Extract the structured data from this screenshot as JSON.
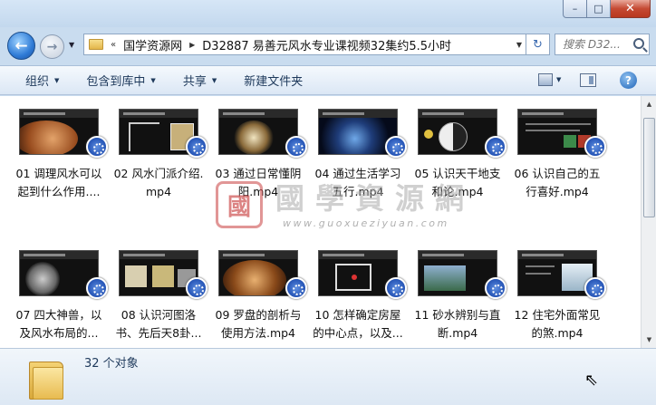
{
  "window": {
    "min_label": "–",
    "max_label": "□",
    "close_label": "✕"
  },
  "nav": {
    "back_label": "←",
    "forward_label": "→",
    "breadcrumb": {
      "overflow": "«",
      "items": [
        "国学资源网",
        "D32887 易善元风水专业课视频32集约5.5小时"
      ]
    },
    "refresh_label": "↻",
    "search_placeholder": "搜索 D32..."
  },
  "toolbar": {
    "items": [
      {
        "label": "组织",
        "dropdown": true
      },
      {
        "label": "包含到库中",
        "dropdown": true
      },
      {
        "label": "共享",
        "dropdown": true
      },
      {
        "label": "新建文件夹",
        "dropdown": false
      }
    ],
    "help_label": "?"
  },
  "files": [
    {
      "line1": "01 调理风水可以",
      "line2": "起到什么作用...."
    },
    {
      "line1": "02 风水门派介绍.",
      "line2": "mp4"
    },
    {
      "line1": "03 通过日常懂阴",
      "line2": "阳.mp4"
    },
    {
      "line1": "04 通过生活学习",
      "line2": "五行.mp4"
    },
    {
      "line1": "05 认识天干地支",
      "line2": "和论.mp4"
    },
    {
      "line1": "06 认识自己的五",
      "line2": "行喜好.mp4"
    },
    {
      "line1": "07 四大神兽，以",
      "line2": "及风水布局的..."
    },
    {
      "line1": "08 认识河图洛",
      "line2": "书、先后天8卦..."
    },
    {
      "line1": "09 罗盘的剖析与",
      "line2": "使用方法.mp4"
    },
    {
      "line1": "10 怎样确定房屋",
      "line2": "的中心点，以及..."
    },
    {
      "line1": "11 砂水辨别与直",
      "line2": "断.mp4"
    },
    {
      "line1": "12 住宅外面常见",
      "line2": "的煞.mp4"
    }
  ],
  "watermark": {
    "seal": "國",
    "text": "國學資源網",
    "url": "www.guoxueziyuan.com"
  },
  "status": {
    "count": "32 个对象"
  }
}
